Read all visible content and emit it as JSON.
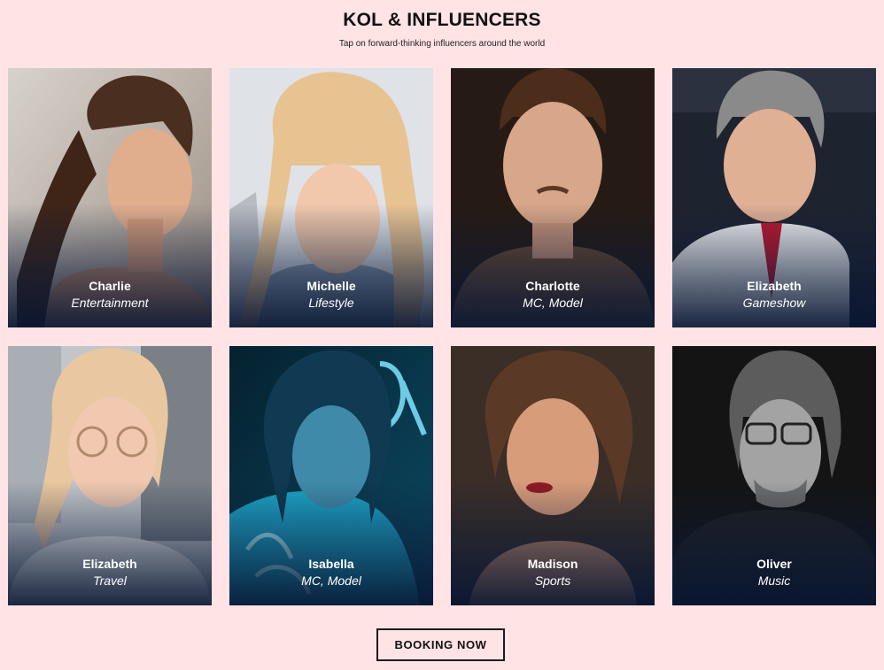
{
  "header": {
    "title": "KOL & INFLUENCERS",
    "subtitle": "Tap on forward-thinking influencers around the world"
  },
  "influencers": [
    {
      "name": "Charlie",
      "category": "Entertainment"
    },
    {
      "name": "Michelle",
      "category": "Lifestyle"
    },
    {
      "name": "Charlotte",
      "category": "MC, Model"
    },
    {
      "name": "Elizabeth",
      "category": "Gameshow"
    },
    {
      "name": "Elizabeth",
      "category": "Travel"
    },
    {
      "name": "Isabella",
      "category": "MC, Model"
    },
    {
      "name": "Madison",
      "category": "Sports"
    },
    {
      "name": "Oliver",
      "category": "Music"
    }
  ],
  "cta": {
    "label": "BOOKING NOW"
  },
  "colors": {
    "background": "#ffe3e5",
    "overlay": "#0a1937",
    "text": "#111111"
  }
}
